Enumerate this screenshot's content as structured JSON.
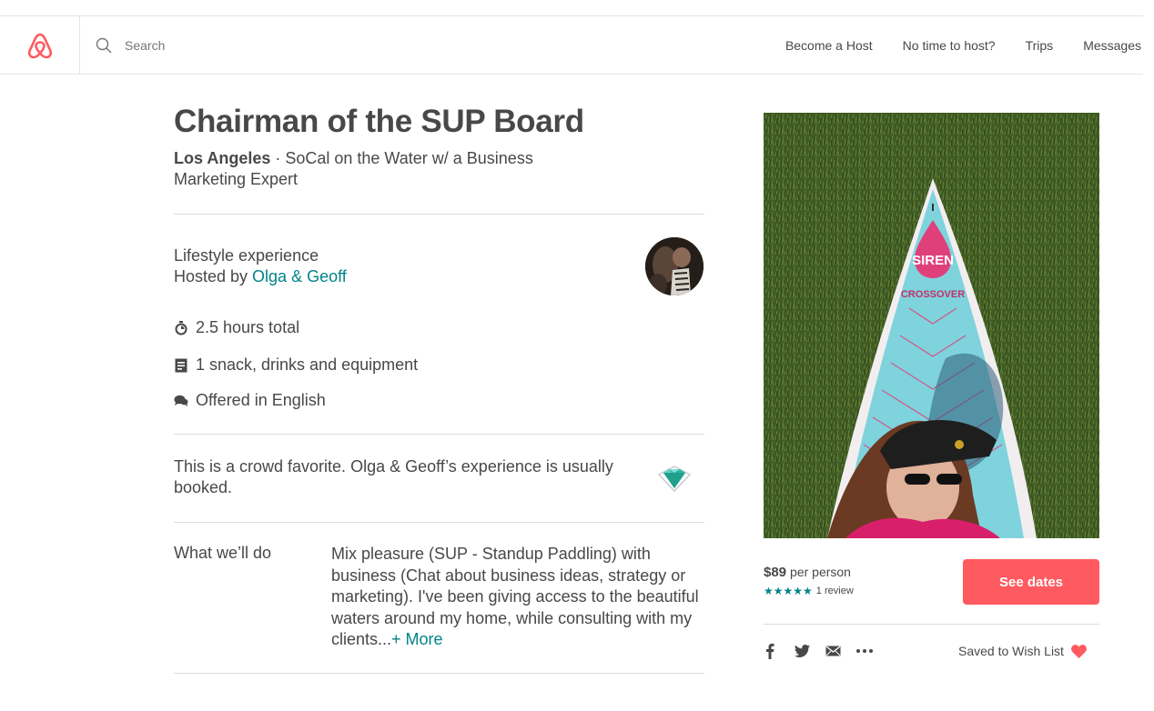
{
  "header": {
    "search_placeholder": "Search",
    "nav": [
      "Become a Host",
      "No time to host?",
      "Trips",
      "Messages"
    ]
  },
  "experience": {
    "title": "Chairman of the SUP Board",
    "city": "Los Angeles",
    "separator": " · ",
    "subtitle": "SoCal on the Water w/ a Business Marketing Expert",
    "type": "Lifestyle experience",
    "hosted_by_prefix": "Hosted by ",
    "host_names": "Olga & Geoff",
    "details": [
      {
        "icon": "clock-icon",
        "text": "2.5 hours total"
      },
      {
        "icon": "list-icon",
        "text": "1 snack, drinks and equipment"
      },
      {
        "icon": "chat-icon",
        "text": "Offered in English"
      }
    ],
    "favorite_text": "This is a crowd favorite. Olga & Geoff’s experience is usually booked.",
    "what_label": "What we’ll do",
    "what_text": "Mix pleasure (SUP - Standup Paddling) with business (Chat about business ideas, strategy or marketing). I've been giving access to the beautiful waters around my home, while consulting with my clients...",
    "more_link": "+ More"
  },
  "booking": {
    "price": "$89",
    "per": "per person",
    "stars": "★★★★★",
    "rating": 5,
    "reviews": "1 review",
    "cta": "See dates",
    "wishlist": "Saved to Wish List"
  },
  "photo": {
    "board_brand": "SIREN",
    "board_model": "CROSSOVER"
  },
  "colors": {
    "brand": "#ff5a5f",
    "link": "#008489",
    "text": "#484848"
  }
}
